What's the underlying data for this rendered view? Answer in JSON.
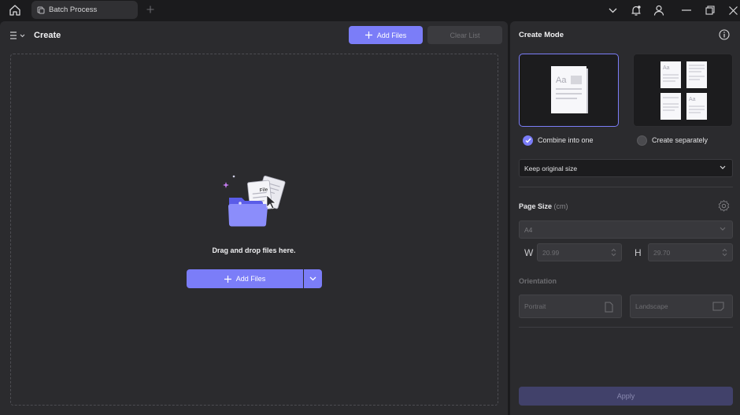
{
  "titlebar": {
    "tab_title": "Batch Process"
  },
  "left": {
    "title": "Create",
    "add_files_label": "Add Files",
    "clear_list_label": "Clear List",
    "drop_text": "Drag and drop files here.",
    "add_files_main_label": "Add Files",
    "illustration_text": "File"
  },
  "right": {
    "title": "Create Mode",
    "mode_options": [
      {
        "label": "Combine into one",
        "selected": true
      },
      {
        "label": "Create separately",
        "selected": false
      }
    ],
    "card_sample_text": "Aa",
    "size_select_value": "Keep original size",
    "page_size_label": "Page Size",
    "page_size_unit": "(cm)",
    "paper_value": "A4",
    "w_label": "W",
    "w_value": "20.99",
    "h_label": "H",
    "h_value": "29.70",
    "orientation_label": "Orientation",
    "portrait_label": "Portrait",
    "landscape_label": "Landscape",
    "apply_label": "Apply"
  },
  "colors": {
    "accent": "#7b7df8",
    "background": "#1b1b1d",
    "panel": "#2b2b2e"
  },
  "icons": [
    "home-icon",
    "tab-doc-icon",
    "plus-icon",
    "chevron-down-icon",
    "bell-icon",
    "user-icon",
    "minimize-icon",
    "restore-icon",
    "close-icon",
    "menu-icon",
    "info-icon",
    "settings-icon",
    "check-icon",
    "portrait-icon",
    "landscape-icon"
  ]
}
